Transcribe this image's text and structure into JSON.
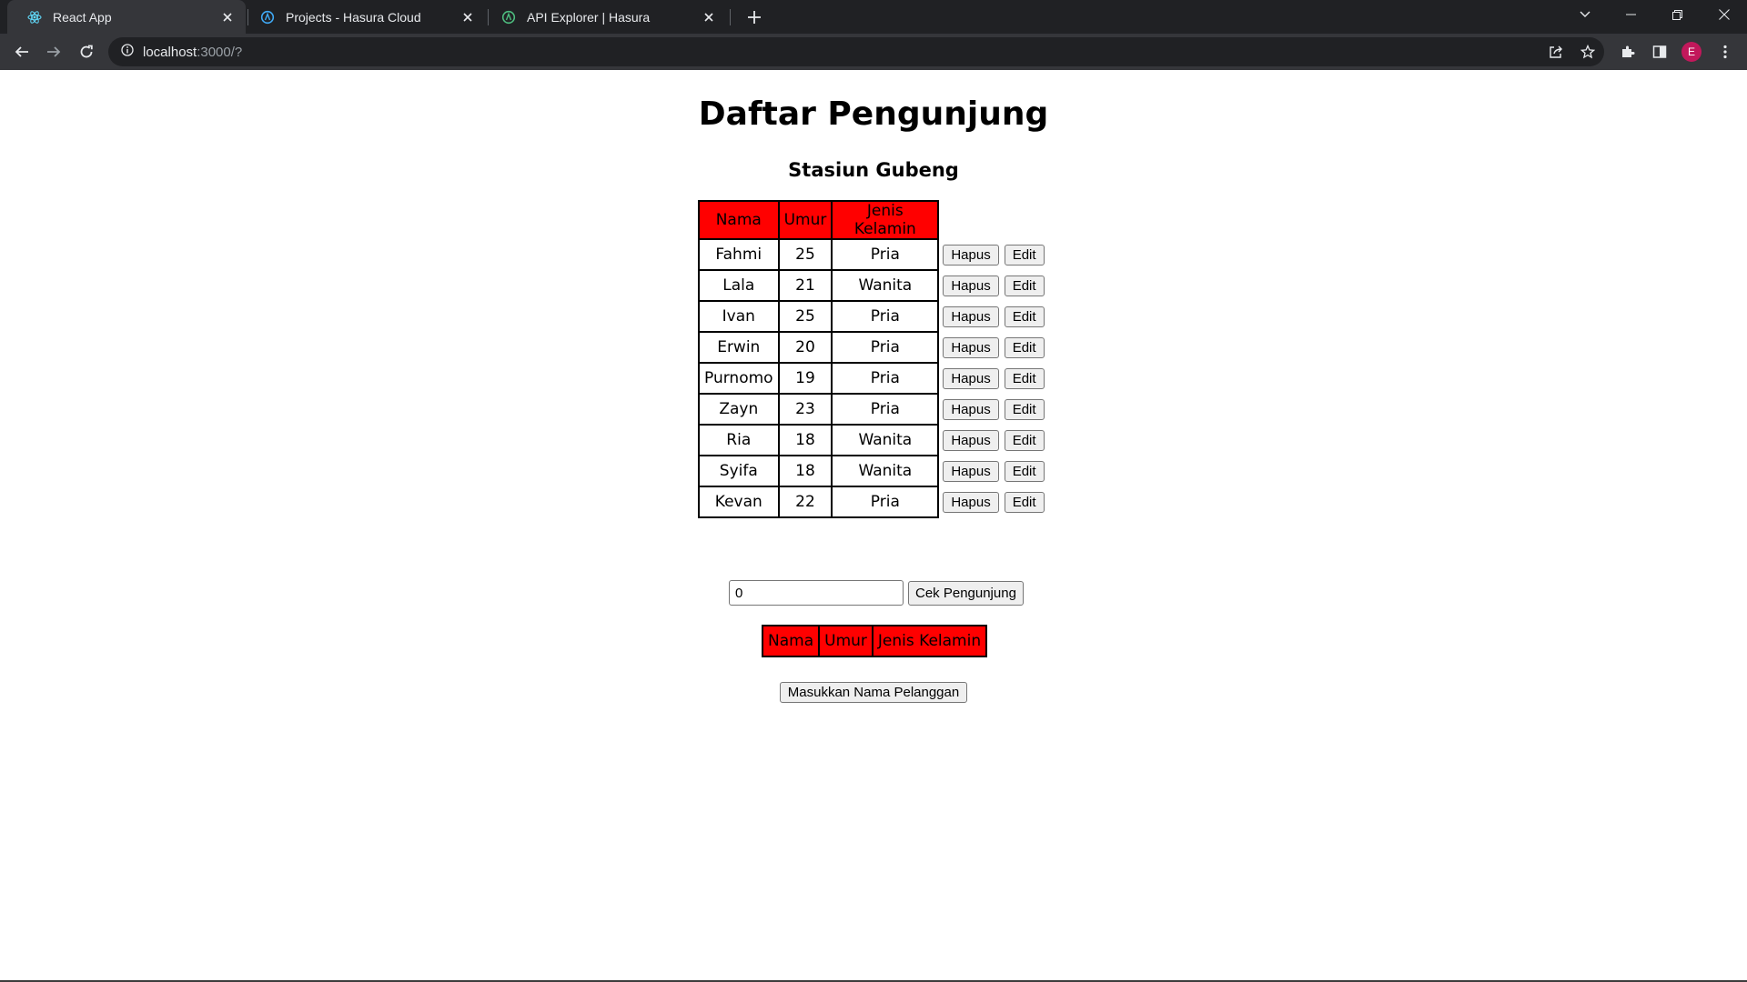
{
  "browser": {
    "tabs": [
      {
        "title": "React App",
        "icon": "react-icon"
      },
      {
        "title": "Projects - Hasura Cloud",
        "icon": "hasura-icon"
      },
      {
        "title": "API Explorer | Hasura",
        "icon": "hasura-icon"
      }
    ],
    "url_host": "localhost",
    "url_rest": ":3000/?",
    "profile_initial": "E"
  },
  "page": {
    "title": "Daftar Pengunjung",
    "subtitle": "Stasiun Gubeng",
    "table": {
      "headers": [
        "Nama",
        "Umur",
        "Jenis Kelamin"
      ],
      "rows": [
        {
          "nama": "Fahmi",
          "umur": "25",
          "jk": "Pria"
        },
        {
          "nama": "Lala",
          "umur": "21",
          "jk": "Wanita"
        },
        {
          "nama": "Ivan",
          "umur": "25",
          "jk": "Pria"
        },
        {
          "nama": "Erwin",
          "umur": "20",
          "jk": "Pria"
        },
        {
          "nama": "Purnomo",
          "umur": "19",
          "jk": "Pria"
        },
        {
          "nama": "Zayn",
          "umur": "23",
          "jk": "Pria"
        },
        {
          "nama": "Ria",
          "umur": "18",
          "jk": "Wanita"
        },
        {
          "nama": "Syifa",
          "umur": "18",
          "jk": "Wanita"
        },
        {
          "nama": "Kevan",
          "umur": "22",
          "jk": "Pria"
        }
      ],
      "delete_label": "Hapus",
      "edit_label": "Edit"
    },
    "check": {
      "input_value": "0",
      "button_label": "Cek Pengunjung"
    },
    "result_table": {
      "headers": [
        "Nama",
        "Umur",
        "Jenis Kelamin"
      ]
    },
    "add_button_label": "Masukkan Nama Pelanggan"
  },
  "colors": {
    "header_bg": "#ff0000",
    "chrome_dark": "#202124",
    "chrome_toolbar": "#35363a",
    "avatar": "#c2185b"
  }
}
